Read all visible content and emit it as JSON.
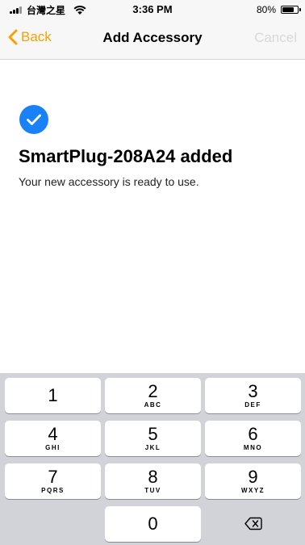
{
  "status_bar": {
    "carrier": "台灣之星",
    "time": "3:36 PM",
    "battery_percent": "80%",
    "battery_level": 0.8
  },
  "nav": {
    "back_label": "Back",
    "title": "Add Accessory",
    "cancel_label": "Cancel"
  },
  "content": {
    "heading": "SmartPlug-208A24 added",
    "subtext": "Your new accessory is ready to use."
  },
  "colors": {
    "accent": "#f4a300",
    "check_blue": "#1a82f7",
    "cancel_disabled": "#d9d9d9",
    "keypad_bg": "#d1d3d9"
  },
  "keypad": {
    "keys": [
      {
        "digit": "1",
        "letters": ""
      },
      {
        "digit": "2",
        "letters": "ABC"
      },
      {
        "digit": "3",
        "letters": "DEF"
      },
      {
        "digit": "4",
        "letters": "GHI"
      },
      {
        "digit": "5",
        "letters": "JKL"
      },
      {
        "digit": "6",
        "letters": "MNO"
      },
      {
        "digit": "7",
        "letters": "PQRS"
      },
      {
        "digit": "8",
        "letters": "TUV"
      },
      {
        "digit": "9",
        "letters": "WXYZ"
      },
      {
        "digit": "0",
        "letters": ""
      }
    ],
    "delete_icon": "delete-backspace-icon"
  }
}
